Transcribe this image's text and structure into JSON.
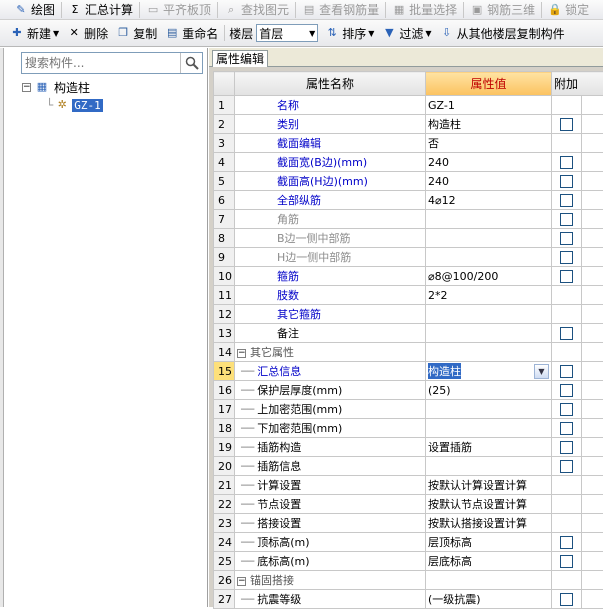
{
  "toolbar1": [
    {
      "label": "绘图",
      "icon": "draw-icon",
      "disabled": false
    },
    {
      "label": "汇总计算",
      "icon": "sigma-icon",
      "disabled": false
    },
    {
      "label": "平齐板顶",
      "icon": "align-slab-icon",
      "disabled": true
    },
    {
      "label": "查找图元",
      "icon": "find-icon",
      "disabled": true
    },
    {
      "label": "查看钢筋量",
      "icon": "view-rebar-icon",
      "disabled": true
    },
    {
      "label": "批量选择",
      "icon": "batch-select-icon",
      "disabled": true
    },
    {
      "label": "钢筋三维",
      "icon": "rebar-3d-icon",
      "disabled": true
    },
    {
      "label": "锁定",
      "icon": "lock-icon",
      "disabled": true
    }
  ],
  "toolbar2": {
    "new_label": "新建",
    "delete_label": "删除",
    "copy_label": "复制",
    "rename_label": "重命名",
    "floor_label": "楼层",
    "floor_value": "首层",
    "sort_label": "排序",
    "filter_label": "过滤",
    "copy_from_label": "从其他楼层复制构件"
  },
  "search": {
    "placeholder": "搜索构件..."
  },
  "tree": {
    "root": "构造柱",
    "child": "GZ-1"
  },
  "panel": {
    "tab": "属性编辑"
  },
  "grid": {
    "headers": {
      "name": "属性名称",
      "value": "属性值",
      "extra": "附加"
    },
    "rows": [
      {
        "num": "1",
        "name": "名称",
        "value": "GZ-1",
        "style": "pn",
        "check": false,
        "indent": "none"
      },
      {
        "num": "2",
        "name": "类别",
        "value": "构造柱",
        "style": "pn",
        "check": true,
        "indent": "none"
      },
      {
        "num": "3",
        "name": "截面编辑",
        "value": "否",
        "style": "pn",
        "check": false,
        "indent": "none"
      },
      {
        "num": "4",
        "name": "截面宽(B边)(mm)",
        "value": "240",
        "style": "pn",
        "check": true,
        "indent": "none"
      },
      {
        "num": "5",
        "name": "截面高(H边)(mm)",
        "value": "240",
        "style": "pn",
        "check": true,
        "indent": "none"
      },
      {
        "num": "6",
        "name": "全部纵筋",
        "value": "4⌀12",
        "style": "pn",
        "check": true,
        "indent": "none"
      },
      {
        "num": "7",
        "name": "角筋",
        "value": "",
        "style": "pn dis",
        "check": true,
        "indent": "none"
      },
      {
        "num": "8",
        "name": "B边一侧中部筋",
        "value": "",
        "style": "pn dis",
        "check": true,
        "indent": "none"
      },
      {
        "num": "9",
        "name": "H边一侧中部筋",
        "value": "",
        "style": "pn dis",
        "check": true,
        "indent": "none"
      },
      {
        "num": "10",
        "name": "箍筋",
        "value": "⌀8@100/200",
        "style": "pn",
        "check": true,
        "indent": "none"
      },
      {
        "num": "11",
        "name": "肢数",
        "value": "2*2",
        "style": "pn",
        "check": false,
        "indent": "none"
      },
      {
        "num": "12",
        "name": "其它箍筋",
        "value": "",
        "style": "pn",
        "check": false,
        "indent": "none"
      },
      {
        "num": "13",
        "name": "备注",
        "value": "",
        "style": "pn blk",
        "check": true,
        "indent": "none"
      },
      {
        "num": "14",
        "name": "其它属性",
        "value": "",
        "style": "pn grp",
        "check": false,
        "indent": "group"
      },
      {
        "num": "15",
        "name": "汇总信息",
        "value": "构造柱",
        "style": "pn",
        "check": true,
        "indent": "child",
        "current": true
      },
      {
        "num": "16",
        "name": "保护层厚度(mm)",
        "value": "(25)",
        "style": "pn blk",
        "check": true,
        "indent": "child"
      },
      {
        "num": "17",
        "name": "上加密范围(mm)",
        "value": "",
        "style": "pn blk",
        "check": true,
        "indent": "child"
      },
      {
        "num": "18",
        "name": "下加密范围(mm)",
        "value": "",
        "style": "pn blk",
        "check": true,
        "indent": "child"
      },
      {
        "num": "19",
        "name": "插筋构造",
        "value": "设置插筋",
        "style": "pn blk",
        "check": true,
        "indent": "child"
      },
      {
        "num": "20",
        "name": "插筋信息",
        "value": "",
        "style": "pn blk",
        "check": true,
        "indent": "child"
      },
      {
        "num": "21",
        "name": "计算设置",
        "value": "按默认计算设置计算",
        "style": "pn blk",
        "check": false,
        "indent": "child"
      },
      {
        "num": "22",
        "name": "节点设置",
        "value": "按默认节点设置计算",
        "style": "pn blk",
        "check": false,
        "indent": "child"
      },
      {
        "num": "23",
        "name": "搭接设置",
        "value": "按默认搭接设置计算",
        "style": "pn blk",
        "check": false,
        "indent": "child"
      },
      {
        "num": "24",
        "name": "顶标高(m)",
        "value": "层顶标高",
        "style": "pn blk",
        "check": true,
        "indent": "child"
      },
      {
        "num": "25",
        "name": "底标高(m)",
        "value": "层底标高",
        "style": "pn blk",
        "check": true,
        "indent": "child"
      },
      {
        "num": "26",
        "name": "锚固搭接",
        "value": "",
        "style": "pn grp",
        "check": false,
        "indent": "group"
      },
      {
        "num": "27",
        "name": "抗震等级",
        "value": "(一级抗震)",
        "style": "pn blk",
        "check": true,
        "indent": "child"
      }
    ]
  }
}
